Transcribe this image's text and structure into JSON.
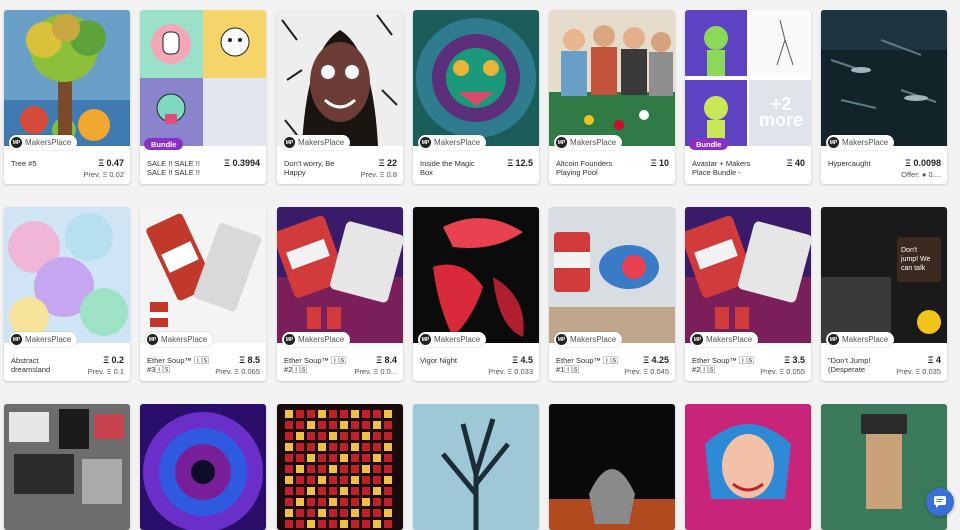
{
  "platform_label": "MakersPlace",
  "bundle_badge": "Bundle",
  "cards": [
    {
      "title": "Tree #5",
      "price": "Ξ 0.47",
      "prev": "Prev. Ξ 0.02",
      "badge": false,
      "image": "tree-art"
    },
    {
      "title": "SALE !! SALE !!\nSALE !! SALE !!",
      "price": "Ξ 0.3994",
      "prev": "",
      "badge": true,
      "image": "cartoon-bundle"
    },
    {
      "title": "Don't worry, Be\nHappy",
      "price": "Ξ 22",
      "prev": "Prev. Ξ 0.8",
      "badge": false,
      "image": "smiling-portrait"
    },
    {
      "title": "Inside the Magic\nBox",
      "price": "Ξ 12.5",
      "prev": "",
      "badge": false,
      "image": "psychedelic-creature"
    },
    {
      "title": "Altcoin Founders\nPlaying Pool",
      "price": "Ξ 10",
      "prev": "",
      "badge": false,
      "image": "pool-players"
    },
    {
      "title": "Avastar + Makers\nPlace Bundle -",
      "price": "Ξ 40",
      "prev": "",
      "badge": true,
      "image": "avatar-bundle",
      "more_label": "+2\nmore"
    },
    {
      "title": "Hypercaught",
      "price": "Ξ 0.0098",
      "prev": "Offer: ● 0....",
      "badge": false,
      "image": "dark-underwater"
    },
    {
      "title": "Abstract\ndreamsland",
      "price": "Ξ 0.2",
      "prev": "Prev. Ξ 0.1",
      "badge": false,
      "image": "pastel-abstract"
    },
    {
      "title": "Ether Soup™ 🄸🅂\n#3🄸🅂",
      "price": "Ξ 8.5",
      "prev": "Prev. Ξ 0.065",
      "badge": false,
      "image": "soup-cans-white"
    },
    {
      "title": "Ether Soup™ 🄸🅂\n#2🄸🅂",
      "price": "Ξ 8.4",
      "prev": "Prev. Ξ 0.0...",
      "badge": false,
      "image": "soup-cans-purple"
    },
    {
      "title": "Vigor Night",
      "price": "Ξ 4.5",
      "prev": "Prev. Ξ 0.033",
      "badge": false,
      "image": "red-shapes"
    },
    {
      "title": "Ether Soup™ 🄸🅂\n#1🄸🅂",
      "price": "Ξ 4.25",
      "prev": "Prev. Ξ 0.045",
      "badge": false,
      "image": "soup-can-room"
    },
    {
      "title": "Ether Soup™ 🄸🅂\n#2🄸🅂",
      "price": "Ξ 3.5",
      "prev": "Prev. Ξ 0.055",
      "badge": false,
      "image": "soup-cans-purple-2"
    },
    {
      "title": "\"Don't Jump!\n(Desperate",
      "price": "Ξ 4",
      "prev": "Prev. Ξ 0.035",
      "badge": false,
      "image": "dont-jump-street",
      "sign_text": "Don't jump! We can talk this out man!"
    },
    {
      "image": "collage-bw"
    },
    {
      "image": "purple-tunnel"
    },
    {
      "image": "red-led-grid"
    },
    {
      "image": "blue-tree"
    },
    {
      "image": "hooded-figure"
    },
    {
      "image": "anime-girl"
    },
    {
      "image": "green-figure"
    }
  ],
  "chat_icon": "chat-bubble-icon"
}
